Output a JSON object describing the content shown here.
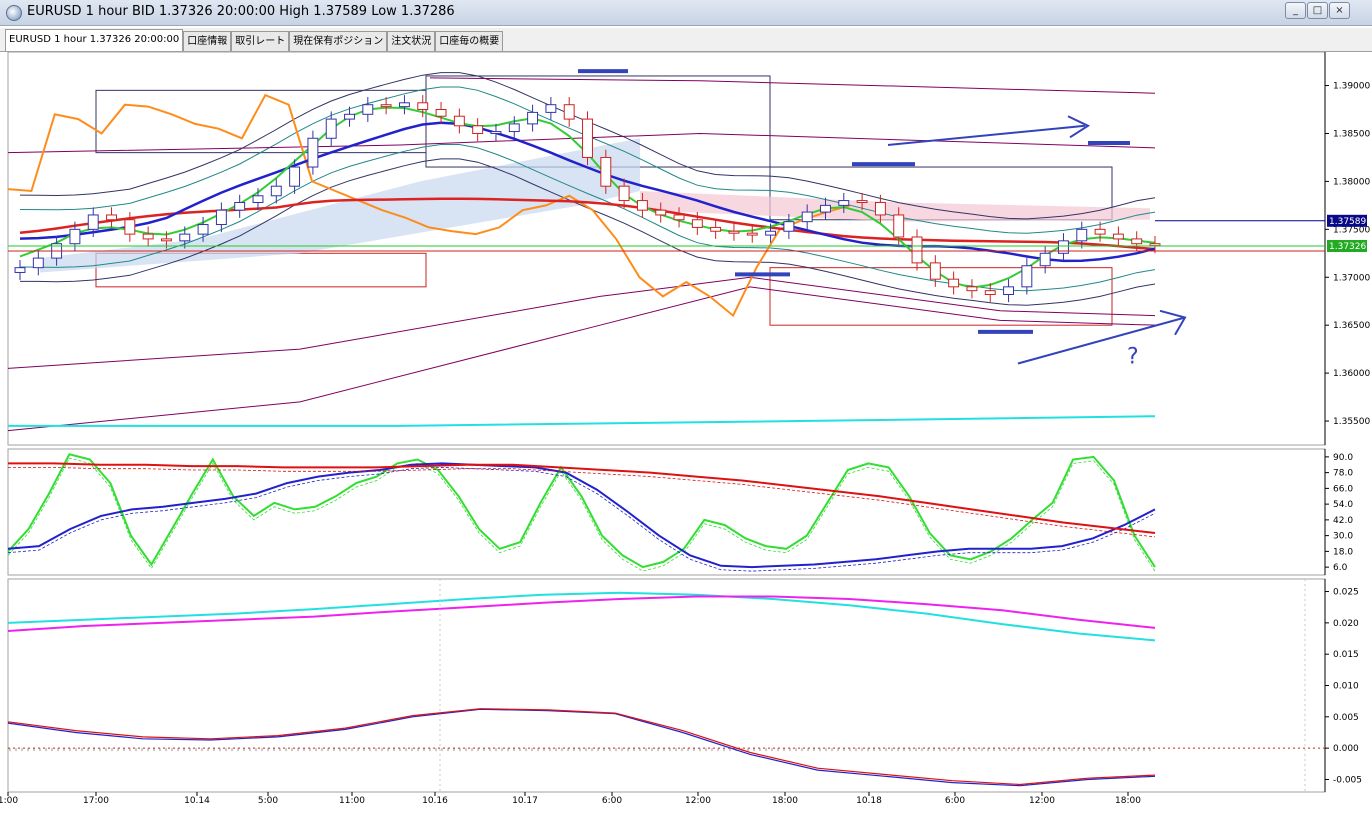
{
  "window": {
    "title": "EURUSD 1 hour BID 1.37326 20:00:00 High 1.37589 Low 1.37286",
    "buttons": [
      "_",
      "□",
      "×"
    ]
  },
  "tabs": [
    {
      "label": "EURUSD 1 hour 1.37326 20:00:00",
      "active": true
    },
    {
      "label": "口座情報",
      "active": false
    },
    {
      "label": "取引レート",
      "active": false
    },
    {
      "label": "現在保有ポジション",
      "active": false
    },
    {
      "label": "注文状況",
      "active": false
    },
    {
      "label": "口座毎の概要",
      "active": false
    }
  ],
  "chart_data": [
    {
      "type": "candlestick",
      "symbol": "EURUSD",
      "timeframe": "1 hour",
      "yticks": [
        "1.39000",
        "1.38500",
        "1.38000",
        "1.37500",
        "1.37000",
        "1.36500",
        "1.36000",
        "1.35500"
      ],
      "ylim": [
        1.3525,
        1.3935
      ],
      "price_labels": {
        "high": "1.37589",
        "close": "1.37326"
      },
      "close_path": [
        1.371,
        1.372,
        1.3735,
        1.375,
        1.3765,
        1.376,
        1.3745,
        1.374,
        1.3738,
        1.3745,
        1.3755,
        1.377,
        1.3778,
        1.3785,
        1.3795,
        1.3815,
        1.3845,
        1.3865,
        1.387,
        1.388,
        1.3878,
        1.3882,
        1.3875,
        1.3868,
        1.3858,
        1.385,
        1.3852,
        1.386,
        1.3872,
        1.388,
        1.3865,
        1.3825,
        1.3795,
        1.378,
        1.377,
        1.3765,
        1.376,
        1.3752,
        1.3748,
        1.3746,
        1.3744,
        1.3748,
        1.3758,
        1.3768,
        1.3775,
        1.378,
        1.3778,
        1.3765,
        1.3742,
        1.3715,
        1.3698,
        1.369,
        1.3686,
        1.3682,
        1.369,
        1.3712,
        1.3725,
        1.3738,
        1.375,
        1.3745,
        1.374,
        1.3735,
        1.3733
      ],
      "annotations": [
        "?"
      ]
    },
    {
      "type": "line",
      "name": "stochastic",
      "yticks": [
        "90.0",
        "78.0",
        "66.0",
        "54.0",
        "42.0",
        "30.0",
        "18.0",
        "6.0"
      ],
      "ylim": [
        0,
        96
      ],
      "series": [
        {
          "values": [
            18,
            35,
            62,
            92,
            88,
            70,
            30,
            8,
            35,
            62,
            88,
            60,
            45,
            55,
            50,
            52,
            60,
            70,
            75,
            85,
            88,
            80,
            60,
            35,
            20,
            25,
            55,
            82,
            60,
            30,
            15,
            6,
            10,
            20,
            42,
            38,
            28,
            22,
            20,
            30,
            55,
            80,
            85,
            82,
            60,
            32,
            15,
            12,
            18,
            28,
            42,
            55,
            88,
            90,
            72,
            30,
            6
          ],
          "color": "#33dd33"
        },
        {
          "values": [
            20,
            22,
            35,
            45,
            50,
            52,
            55,
            58,
            62,
            70,
            75,
            78,
            80,
            84,
            85,
            84,
            83,
            82,
            78,
            65,
            48,
            30,
            15,
            7,
            6,
            7,
            8,
            10,
            12,
            15,
            18,
            20,
            20,
            20,
            22,
            28,
            38,
            50
          ],
          "color": "#2222cc"
        },
        {
          "values": [
            85,
            85,
            84,
            84,
            83,
            83,
            82,
            82,
            82,
            83,
            84,
            84,
            82,
            80,
            78,
            75,
            72,
            68,
            64,
            60,
            55,
            50,
            45,
            40,
            36,
            32
          ],
          "color": "#dd1111"
        }
      ]
    },
    {
      "type": "line",
      "name": "oscillator",
      "yticks": [
        "0.025",
        "0.020",
        "0.015",
        "0.010",
        "0.005",
        "0.000",
        "-0.005"
      ],
      "ylim": [
        -0.007,
        0.027
      ],
      "series": [
        {
          "values": [
            0.02,
            0.0205,
            0.021,
            0.0215,
            0.0222,
            0.023,
            0.0238,
            0.0245,
            0.0248,
            0.0245,
            0.0238,
            0.0228,
            0.0215,
            0.0198,
            0.0183,
            0.0172
          ],
          "color": "#22e0e0"
        },
        {
          "values": [
            0.0187,
            0.0195,
            0.02,
            0.0205,
            0.021,
            0.0218,
            0.0225,
            0.0232,
            0.0238,
            0.0242,
            0.0242,
            0.0238,
            0.023,
            0.022,
            0.0205,
            0.0192
          ],
          "color": "#ee22ee"
        },
        {
          "values": [
            0.004,
            0.0025,
            0.0015,
            0.0013,
            0.0018,
            0.003,
            0.005,
            0.0062,
            0.006,
            0.0055,
            0.0025,
            -0.001,
            -0.0035,
            -0.0045,
            -0.0055,
            -0.006,
            -0.005,
            -0.0045
          ],
          "color": "#2222cc"
        },
        {
          "values": [
            0.0042,
            0.0028,
            0.0018,
            0.0015,
            0.002,
            0.0032,
            0.0052,
            0.0063,
            0.0061,
            0.0056,
            0.0028,
            -0.0007,
            -0.0032,
            -0.0042,
            -0.0052,
            -0.0058,
            -0.0048,
            -0.0043
          ],
          "color": "#dd1111"
        }
      ]
    }
  ],
  "xaxis": {
    "labels": [
      "1:00",
      "17:00",
      "10.14",
      "5:00",
      "11:00",
      "10.16",
      "10.17",
      "6:00",
      "12:00",
      "18:00",
      "10.18",
      "6:00",
      "12:00",
      "18:00"
    ]
  },
  "colors": {
    "grid": "#e0e0e0",
    "panel_border": "#a0a0a0",
    "bull": "#3333aa",
    "bear": "#cc2222",
    "ma_green": "#33cc33",
    "ma_blue": "#2222cc",
    "ma_red": "#dd2222",
    "orange": "#ff8c1a",
    "cyan": "#22e0e0",
    "purple": "#800060",
    "teal": "#228888"
  }
}
